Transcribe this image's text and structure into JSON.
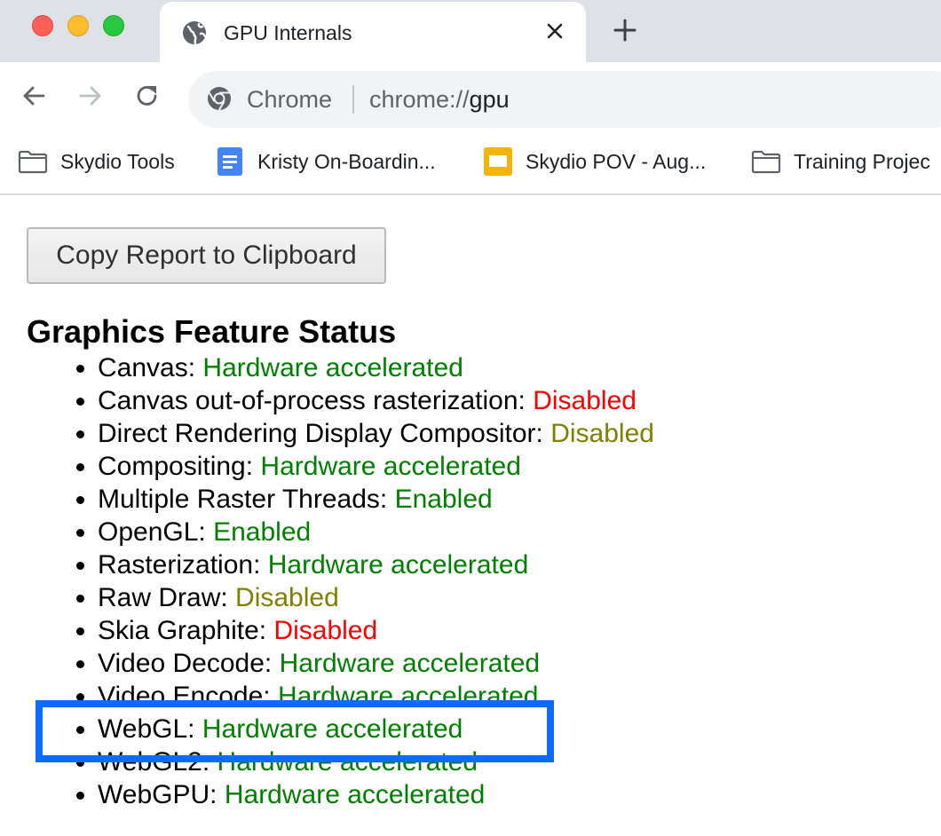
{
  "browser": {
    "tab": {
      "title": "GPU Internals",
      "favicon": "globe-icon",
      "close": "close-icon"
    },
    "new_tab": "plus-icon",
    "nav": {
      "back": "back-arrow-icon",
      "forward": "forward-arrow-icon",
      "reload": "reload-icon"
    },
    "omnibox": {
      "label": "Chrome",
      "url_scheme": "chrome://",
      "url_host": "gpu",
      "icon": "chrome-icon"
    },
    "bookmarks": [
      {
        "label": "Skydio Tools",
        "icon": "folder-icon"
      },
      {
        "label": "Kristy On-Boardin...",
        "icon": "google-docs-icon"
      },
      {
        "label": "Skydio POV - Aug...",
        "icon": "google-slides-icon"
      },
      {
        "label": "Training Projec",
        "icon": "folder-icon"
      }
    ]
  },
  "page": {
    "copy_button": "Copy Report to Clipboard",
    "section_title": "Graphics Feature Status",
    "features": [
      {
        "name": "Canvas:",
        "status": "Hardware accelerated",
        "status_color": "#008000"
      },
      {
        "name": "Canvas out-of-process rasterization:",
        "status": "Disabled",
        "status_color": "#ff0000"
      },
      {
        "name": "Direct Rendering Display Compositor:",
        "status": "Disabled",
        "status_color": "#808000"
      },
      {
        "name": "Compositing:",
        "status": "Hardware accelerated",
        "status_color": "#008000"
      },
      {
        "name": "Multiple Raster Threads:",
        "status": "Enabled",
        "status_color": "#008000"
      },
      {
        "name": "OpenGL:",
        "status": "Enabled",
        "status_color": "#008000"
      },
      {
        "name": "Rasterization:",
        "status": "Hardware accelerated",
        "status_color": "#008000"
      },
      {
        "name": "Raw Draw:",
        "status": "Disabled",
        "status_color": "#808000"
      },
      {
        "name": "Skia Graphite:",
        "status": "Disabled",
        "status_color": "#ff0000"
      },
      {
        "name": "Video Decode:",
        "status": "Hardware accelerated",
        "status_color": "#008000"
      },
      {
        "name": "Video Encode:",
        "status": "Hardware accelerated",
        "status_color": "#008000"
      },
      {
        "name": "WebGL:",
        "status": "Hardware accelerated",
        "status_color": "#008000"
      },
      {
        "name": "WebGL2:",
        "status": "Hardware accelerated",
        "status_color": "#008000"
      },
      {
        "name": "WebGPU:",
        "status": "Hardware accelerated",
        "status_color": "#008000"
      }
    ],
    "highlight_color": "#0a6cff"
  }
}
